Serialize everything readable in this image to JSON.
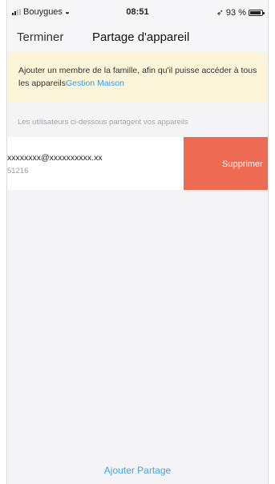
{
  "status_bar": {
    "carrier": "Bouygues",
    "time": "08:51",
    "battery_text": "93 %",
    "icons": [
      "signal-icon",
      "wifi-icon",
      "location-arrow-icon",
      "battery-icon"
    ]
  },
  "nav": {
    "back_label": "Terminer",
    "title": "Partage d'appareil"
  },
  "notice": {
    "text": "Ajouter un membre de la famille, afin qu'il puisse accéder à tous les appareils",
    "link": "Gestion Maison"
  },
  "list": {
    "header": "Les utilisateurs ci-dessous partagent vos appareils",
    "users": [
      {
        "email": "xxxxxxxx@xxxxxxxxxx.xx",
        "sub": "51216"
      }
    ],
    "delete_label": "Supprimer"
  },
  "footer": {
    "add_label": "Ajouter Partage"
  },
  "colors": {
    "delete": "#ed6a53",
    "link": "#3a9ad9",
    "notice_bg": "#fdf5da"
  }
}
